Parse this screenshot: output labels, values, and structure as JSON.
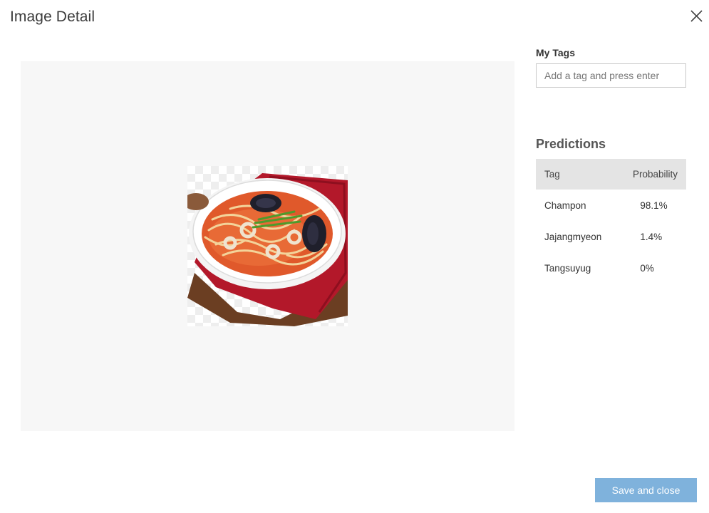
{
  "dialog": {
    "title": "Image Detail",
    "close_icon": "close-icon"
  },
  "image": {
    "description_icon": "food-photo",
    "accent_colors": {
      "bowl": "#ffffff",
      "broth": "#e0592b",
      "napkin": "#b3182a",
      "board": "#6b3e22",
      "mussel": "#1f1f2b",
      "scallion": "#4f9a2c"
    }
  },
  "my_tags": {
    "label": "My Tags",
    "placeholder": "Add a tag and press enter",
    "value": ""
  },
  "predictions": {
    "heading": "Predictions",
    "columns": [
      "Tag",
      "Probability"
    ],
    "rows": [
      {
        "tag": "Champon",
        "probability": "98.1%"
      },
      {
        "tag": "Jajangmyeon",
        "probability": "1.4%"
      },
      {
        "tag": "Tangsuyug",
        "probability": "0%"
      }
    ]
  },
  "footer": {
    "save_label": "Save and close",
    "save_color": "#7fb2dc"
  }
}
